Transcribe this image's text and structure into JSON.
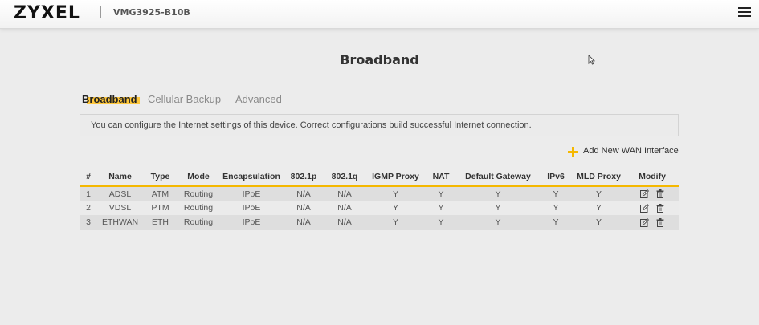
{
  "header": {
    "logo": "ZYXEL",
    "model": "VMG3925-B10B",
    "menu_icon": "hamburger-menu-icon"
  },
  "page": {
    "title": "Broadband"
  },
  "tabs": [
    {
      "label": "Broadband",
      "active": true
    },
    {
      "label": "Cellular Backup",
      "active": false
    },
    {
      "label": "Advanced",
      "active": false
    }
  ],
  "info": "You can configure the Internet settings of this device. Correct configurations build successful Internet connection.",
  "add_wan": {
    "label": "Add New WAN Interface",
    "icon": "plus-icon"
  },
  "table": {
    "headers": [
      "#",
      "Name",
      "Type",
      "Mode",
      "Encapsulation",
      "802.1p",
      "802.1q",
      "IGMP Proxy",
      "NAT",
      "Default Gateway",
      "IPv6",
      "MLD Proxy",
      "Modify"
    ],
    "rows": [
      [
        "1",
        "ADSL",
        "ATM",
        "Routing",
        "IPoE",
        "N/A",
        "N/A",
        "Y",
        "Y",
        "Y",
        "Y",
        "Y"
      ],
      [
        "2",
        "VDSL",
        "PTM",
        "Routing",
        "IPoE",
        "N/A",
        "N/A",
        "Y",
        "Y",
        "Y",
        "Y",
        "Y"
      ],
      [
        "3",
        "ETHWAN",
        "ETH",
        "Routing",
        "IPoE",
        "N/A",
        "N/A",
        "Y",
        "Y",
        "Y",
        "Y",
        "Y"
      ]
    ],
    "modify_icons": [
      "edit-icon",
      "trash-icon"
    ]
  },
  "colors": {
    "accent": "#f5b800",
    "background": "#ececec",
    "row_odd": "#dedede",
    "row_even": "#ebebeb"
  }
}
